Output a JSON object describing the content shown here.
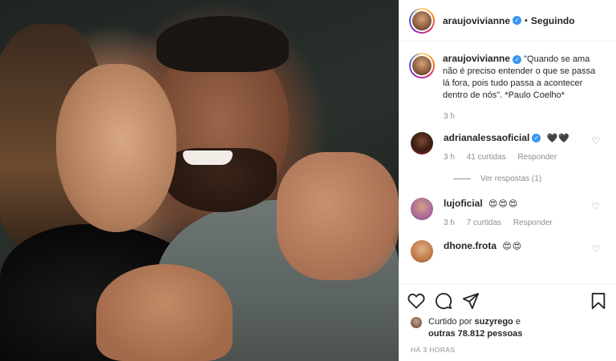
{
  "post": {
    "author": "araujovivianne",
    "separator": "•",
    "follow_status": "Seguindo"
  },
  "caption": {
    "username": "araujovivianne",
    "text": "\"Quando se ama não é preciso entender o que se passa lá fora, pois tudo passa a acontecer dentro de nós\". *Paulo Coelho*",
    "time": "3 h"
  },
  "comments": [
    {
      "username": "adrianalessaoficial",
      "verified": true,
      "text": "🖤🖤",
      "time": "3 h",
      "likes": "41 curtidas",
      "reply": "Responder",
      "view_replies": "Ver respostas (1)"
    },
    {
      "username": "lujoficial",
      "verified": false,
      "text": "😍😍😍",
      "time": "3 h",
      "likes": "7 curtidas",
      "reply": "Responder"
    },
    {
      "username": "dhone.frota",
      "verified": false,
      "text": "😍😍"
    }
  ],
  "likes_line": {
    "prefix": "Curtido por",
    "liker": "suzyrego",
    "conj": "e",
    "others": "outras 78.812 pessoas"
  },
  "timestamp": "HÁ 3 HORAS",
  "icons": [
    "verified-badge-icon",
    "heart-icon",
    "comment-icon",
    "share-icon",
    "bookmark-icon"
  ]
}
